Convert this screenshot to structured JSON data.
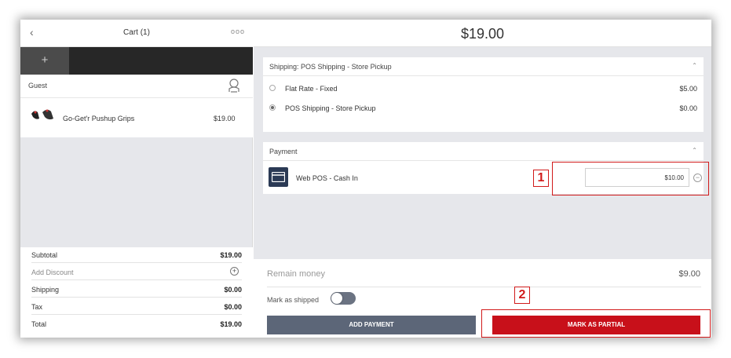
{
  "cart": {
    "title": "Cart (1)",
    "more_menu": "ooo",
    "new_cart_label": "+",
    "customer": "Guest",
    "items": [
      {
        "name": "Go-Get'r Pushup Grips",
        "price": "$19.00"
      }
    ],
    "totals": [
      {
        "label": "Subtotal",
        "value": "$19.00"
      },
      {
        "label": "Add Discount",
        "value": ""
      },
      {
        "label": "Shipping",
        "value": "$0.00"
      },
      {
        "label": "Tax",
        "value": "$0.00"
      },
      {
        "label": "Total",
        "value": "$19.00"
      }
    ]
  },
  "checkout": {
    "grand_total": "$19.00",
    "shipping": {
      "title": "Shipping: POS Shipping - Store Pickup",
      "options": [
        {
          "name": "Flat Rate - Fixed",
          "price": "$5.00",
          "selected": false
        },
        {
          "name": "POS Shipping - Store Pickup",
          "price": "$0.00",
          "selected": true
        }
      ]
    },
    "payment": {
      "title": "Payment",
      "method": "Web POS - Cash In",
      "amount": "$10.00"
    },
    "remain_label": "Remain money",
    "remain_value": "$9.00",
    "mark_shipped_label": "Mark as shipped",
    "mark_shipped": false,
    "add_payment_label": "ADD PAYMENT",
    "mark_partial_label": "MARK AS PARTIAL"
  },
  "callouts": [
    "1",
    "2"
  ],
  "colors": {
    "primary_button": "#5c6678",
    "accent_red": "#c8101a",
    "tabbar": "#272727"
  },
  "icons": [
    "back-arrow-icon",
    "more-dots-icon",
    "plus-icon",
    "customer-icon",
    "plus-circle-icon",
    "caret-up-icon",
    "radio-icon",
    "cash-in-icon",
    "minus-circle-icon"
  ]
}
